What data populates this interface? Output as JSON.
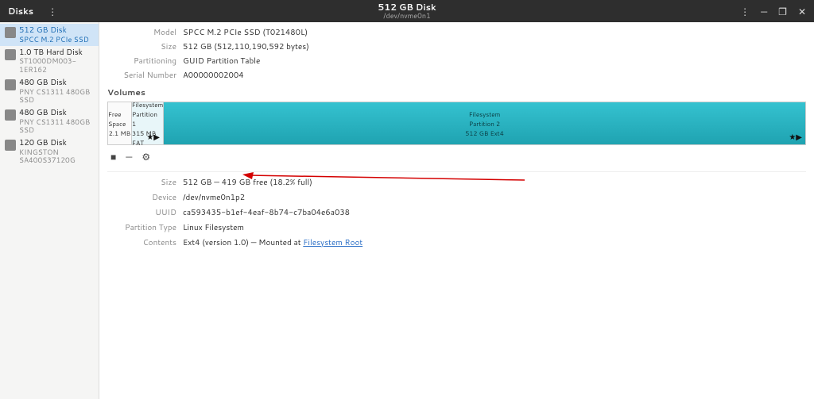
{
  "header": {
    "app_name": "Disks",
    "title": "512 GB Disk",
    "subtitle": "/dev/nvme0n1"
  },
  "sidebar": {
    "items": [
      {
        "title": "512 GB Disk",
        "sub": "SPCC M.2 PCIe SSD"
      },
      {
        "title": "1.0 TB Hard Disk",
        "sub": "ST1000DM003-1ER162"
      },
      {
        "title": "480 GB Disk",
        "sub": "PNY CS1311 480GB SSD"
      },
      {
        "title": "480 GB Disk",
        "sub": "PNY CS1311 480GB SSD"
      },
      {
        "title": "120 GB Disk",
        "sub": "KINGSTON SA400S37120G"
      }
    ]
  },
  "disk_info": {
    "model_label": "Model",
    "model": "SPCC M.2 PCIe SSD (T021480L)",
    "size_label": "Size",
    "size": "512 GB (512,110,190,592 bytes)",
    "part_label": "Partitioning",
    "part": "GUID Partition Table",
    "serial_label": "Serial Number",
    "serial": "A00000002004"
  },
  "volumes_heading": "Volumes",
  "vol_map": {
    "free": {
      "l1": "Free Space",
      "l2": "2.1 MB"
    },
    "p1": {
      "l1": "Filesystem",
      "l2": "Partition 1",
      "l3": "315 MB FAT"
    },
    "p2": {
      "l1": "Filesystem",
      "l2": "Partition 2",
      "l3": "512 GB Ext4"
    }
  },
  "partition_detail": {
    "size_label": "Size",
    "size": "512 GB — 419 GB free (18.2% full)",
    "device_label": "Device",
    "device": "/dev/nvme0n1p2",
    "uuid_label": "UUID",
    "uuid": "ca593435-b1ef-4eaf-8b74-c7ba04e6a038",
    "ptype_label": "Partition Type",
    "ptype": "Linux Filesystem",
    "contents_label": "Contents",
    "contents_prefix": "Ext4 (version 1.0) — Mounted at ",
    "contents_link": "Filesystem Root"
  }
}
